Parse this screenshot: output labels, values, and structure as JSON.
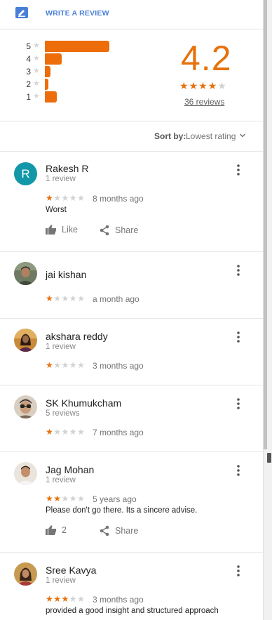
{
  "write_review": {
    "label": "WRITE A REVIEW",
    "icon": "write-review-icon"
  },
  "summary": {
    "rating": "4.2",
    "stars_filled": 4,
    "review_count_link": "36 reviews",
    "histogram": [
      {
        "label": "5",
        "share": 0.8
      },
      {
        "label": "4",
        "share": 0.21
      },
      {
        "label": "3",
        "share": 0.07
      },
      {
        "label": "2",
        "share": 0.04
      },
      {
        "label": "1",
        "share": 0.15
      }
    ]
  },
  "sort": {
    "label": "Sort by:",
    "value": "Lowest rating"
  },
  "colors": {
    "accent_orange": "#e8710a",
    "link_blue": "#4a7fd8",
    "avatar_teal": "#1197a8"
  },
  "reviews": [
    {
      "name": "Rakesh R",
      "subtitle": "1 review",
      "rating": 1,
      "time": "8 months ago",
      "text": "Worst",
      "avatar_letter": "R",
      "like_label": "Like",
      "share_label": "Share"
    },
    {
      "name": "jai kishan",
      "subtitle": "",
      "rating": 1,
      "time": "a month ago",
      "text": ""
    },
    {
      "name": "akshara reddy",
      "subtitle": "1 review",
      "rating": 1,
      "time": "3 months ago",
      "text": ""
    },
    {
      "name": "SK Khumukcham",
      "subtitle": "5 reviews",
      "rating": 1,
      "time": "7 months ago",
      "text": ""
    },
    {
      "name": "Jag Mohan",
      "subtitle": "1 review",
      "rating": 2,
      "time": "5 years ago",
      "text": "Please don't go there. Its a sincere advise.",
      "like_count": "2",
      "share_label": "Share"
    },
    {
      "name": "Sree Kavya",
      "subtitle": "1 review",
      "rating": 3,
      "time": "3 months ago",
      "text": "provided a good insight and structured approach"
    }
  ]
}
